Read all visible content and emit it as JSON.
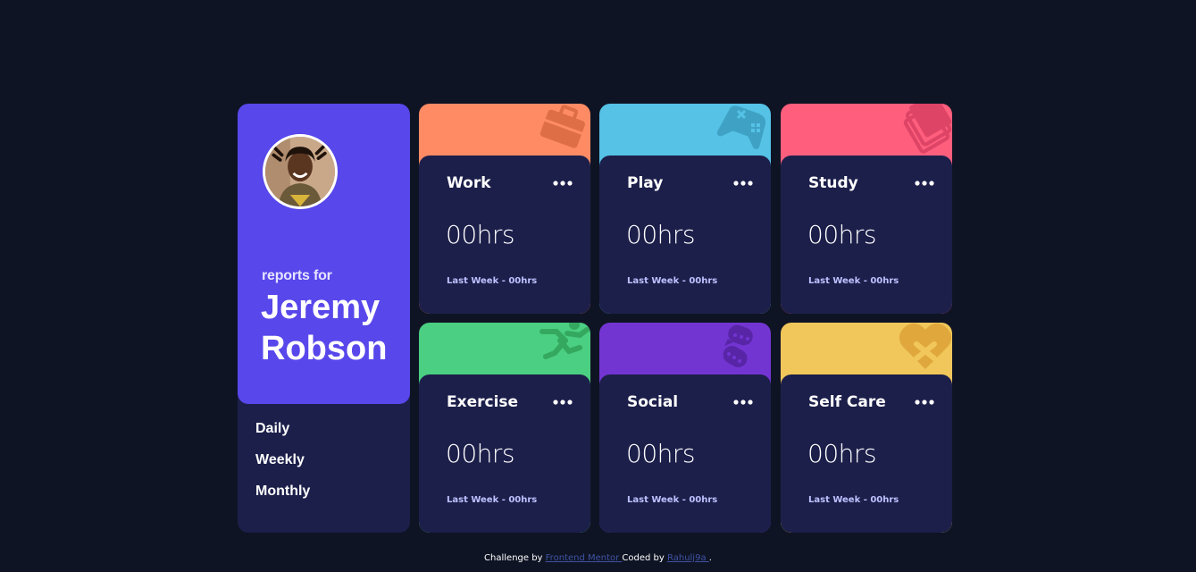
{
  "profile": {
    "reports_for": "reports for",
    "name": "Jeremy Robson",
    "avatar_icon": "user-avatar-photo",
    "colors": {
      "panel": "#1c1f4a",
      "header": "#5847eb"
    }
  },
  "periods": [
    {
      "label": "Daily",
      "selected": false
    },
    {
      "label": "Weekly",
      "selected": false
    },
    {
      "label": "Monthly",
      "selected": false
    }
  ],
  "cards": [
    {
      "title": "Work",
      "hours": "00hrs",
      "last_week": "Last Week - 00hrs",
      "color": "#ff8b64",
      "icon": "briefcase-icon"
    },
    {
      "title": "Play",
      "hours": "00hrs",
      "last_week": "Last Week - 00hrs",
      "color": "#55c2e6",
      "icon": "gamepad-icon"
    },
    {
      "title": "Study",
      "hours": "00hrs",
      "last_week": "Last Week - 00hrs",
      "color": "#ff5e7d",
      "icon": "books-icon"
    },
    {
      "title": "Exercise",
      "hours": "00hrs",
      "last_week": "Last Week - 00hrs",
      "color": "#4bcf82",
      "icon": "running-icon"
    },
    {
      "title": "Social",
      "hours": "00hrs",
      "last_week": "Last Week - 00hrs",
      "color": "#7335d2",
      "icon": "chat-icon"
    },
    {
      "title": "Self Care",
      "hours": "00hrs",
      "last_week": "Last Week - 00hrs",
      "color": "#f1c75b",
      "icon": "heart-plus-icon"
    }
  ],
  "footer": {
    "challenge_prefix": "Challenge by ",
    "challenge_link": " Frontend Mentor ",
    "coded_prefix": " Coded by ",
    "coded_link": " Rahulj9a ",
    "suffix": "."
  },
  "colors": {
    "background": "#0f1424",
    "card_body": "#1c1f4a",
    "muted_text": "#bdc1ff"
  }
}
